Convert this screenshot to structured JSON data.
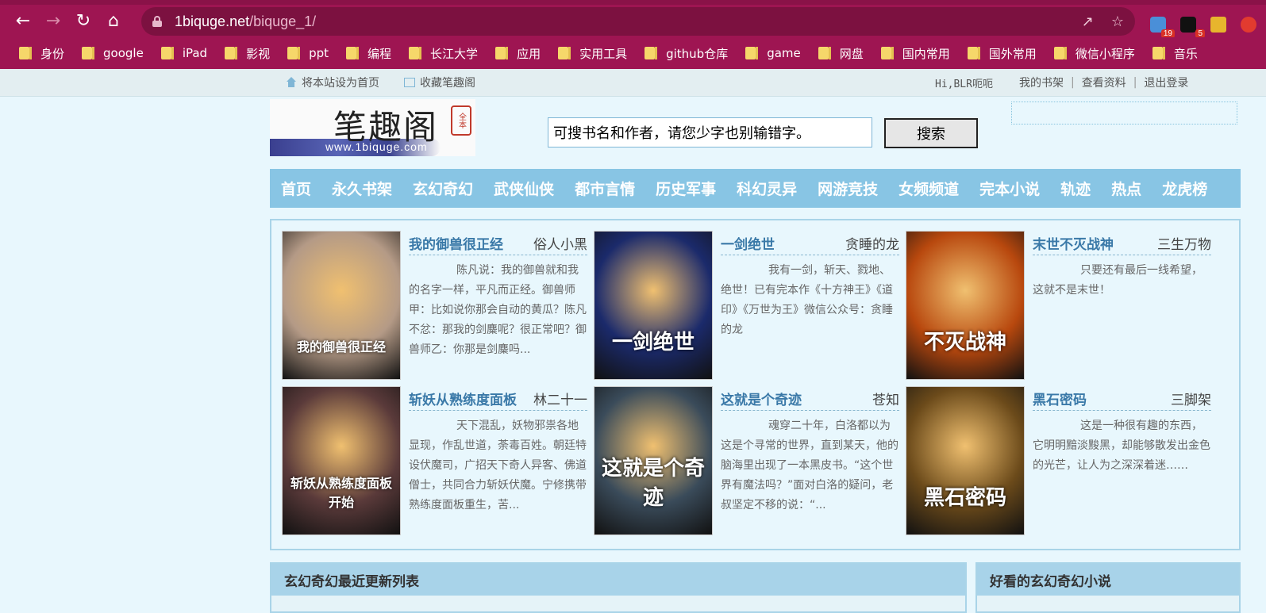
{
  "browser": {
    "url_host": "1biquge.net",
    "url_path": "/biquge_1/",
    "ext_badges": [
      "19",
      "5"
    ],
    "bookmarks": [
      "身份",
      "google",
      "iPad",
      "影视",
      "ppt",
      "编程",
      "长江大学",
      "应用",
      "实用工具",
      "github仓库",
      "game",
      "网盘",
      "国内常用",
      "国外常用",
      "微信小程序",
      "音乐"
    ]
  },
  "site_top": {
    "set_home": "将本站设为首页",
    "favorite": "收藏笔趣阁",
    "greeting": "Hi,BLR呃呃",
    "bookshelf": "我的书架",
    "profile": "查看资料",
    "logout": "退出登录"
  },
  "logo": {
    "title": "笔趣阁",
    "domain": "www.1biquge.com",
    "seal": "全本"
  },
  "search": {
    "value": "可搜书名和作者，请您少字也别输错字。",
    "button": "搜索"
  },
  "nav": [
    "首页",
    "永久书架",
    "玄幻奇幻",
    "武侠仙侠",
    "都市言情",
    "历史军事",
    "科幻灵异",
    "网游竞技",
    "女频频道",
    "完本小说",
    "轨迹",
    "热点",
    "龙虎榜"
  ],
  "books": [
    {
      "title": "我的御兽很正经",
      "author": "俗人小黑",
      "desc": "陈凡说：我的御兽就和我的名字一样，平凡而正经。御兽师甲：比如说你那会自动的黄瓜？陈凡不忿：那我的剑麋呢？很正常吧？御兽师乙：你那是剑麋吗...",
      "cover_text": "我的御兽很正经",
      "cover_color": "#b49a86"
    },
    {
      "title": "一剑绝世",
      "author": "贪睡的龙",
      "desc": "我有一剑，斩天、戮地、绝世！已有完本作《十方神王》《道印》《万世为王》微信公众号：贪睡的龙",
      "cover_text": "一剑绝世",
      "cover_color": "#1b2a6b"
    },
    {
      "title": "末世不灭战神",
      "author": "三生万物",
      "desc": "只要还有最后一线希望，这就不是末世！",
      "cover_text": "不灭战神",
      "cover_color": "#b8480e"
    },
    {
      "title": "斩妖从熟练度面板",
      "author": "林二十一",
      "desc": "天下混乱，妖物邪祟各地显现，作乱世道，荼毒百姓。朝廷特设伏魔司，广招天下奇人异客、佛道僧士，共同合力斩妖伏魔。宁修携带熟练度面板重生，苦...",
      "cover_text": "斩妖从熟练度面板开始",
      "cover_color": "#5a3a3a"
    },
    {
      "title": "这就是个奇迹",
      "author": "苍知",
      "desc": "魂穿二十年，白洛都以为这是个寻常的世界，直到某天，他的脑海里出现了一本黑皮书。“这个世界有魔法吗？”面对白洛的疑问，老叔坚定不移的说：“...",
      "cover_text": "这就是个奇迹",
      "cover_color": "#3a4b5a"
    },
    {
      "title": "黑石密码",
      "author": "三脚架",
      "desc": "这是一种很有趣的东西，它明明黯淡黢黑，却能够散发出金色的光芒，让人为之深深着迷……",
      "cover_text": "黑石密码",
      "cover_color": "#6b4a1a"
    }
  ],
  "sections": {
    "left": "玄幻奇幻最近更新列表",
    "right": "好看的玄幻奇幻小说"
  }
}
